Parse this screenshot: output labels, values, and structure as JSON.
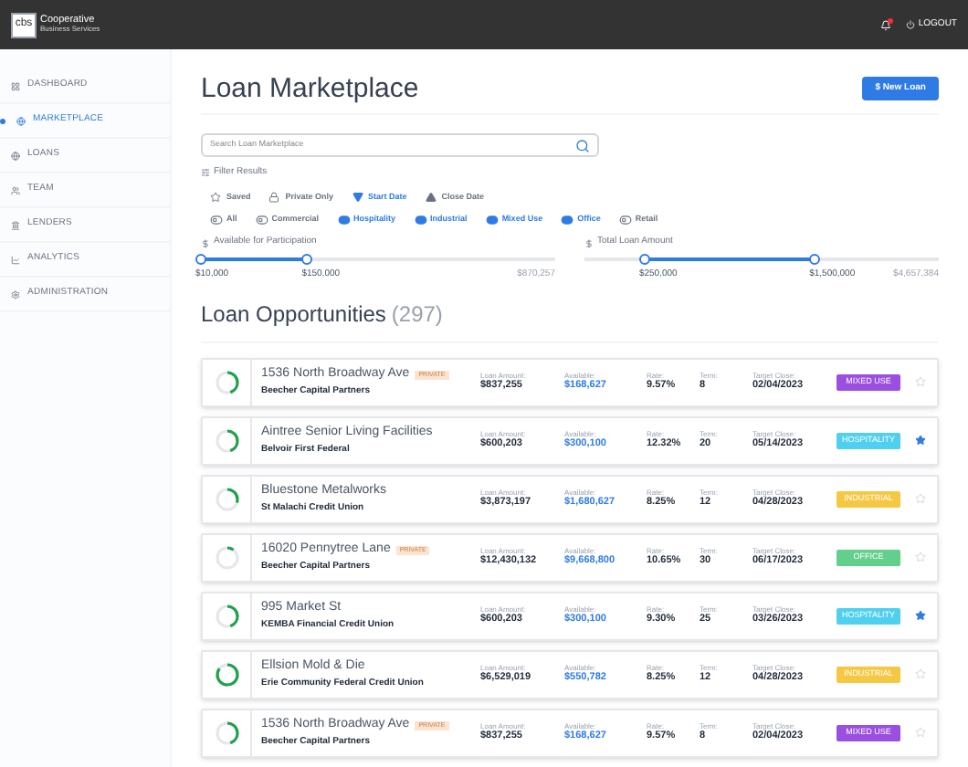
{
  "header": {
    "logo": "cbs",
    "brand": "Cooperative",
    "tagline": "Business Services",
    "logout": "LOGOUT"
  },
  "sidebar": {
    "items": [
      {
        "label": "DASHBOARD",
        "selected": false
      },
      {
        "label": "MARKETPLACE",
        "selected": true
      },
      {
        "label": "LOANS",
        "selected": false
      },
      {
        "label": "TEAM",
        "selected": false
      },
      {
        "label": "LENDERS",
        "selected": false
      },
      {
        "label": "ANALYTICS",
        "selected": false
      },
      {
        "label": "ADMINISTRATION",
        "selected": false
      }
    ]
  },
  "page": {
    "title": "Loan Marketplace",
    "new_button": "$ New Loan"
  },
  "search": {
    "placeholder": "Search Loan Marketplace"
  },
  "filters": {
    "label": "Filter Results",
    "sort": [
      {
        "kind": "star",
        "label": "Saved",
        "selected": false
      },
      {
        "kind": "lock",
        "label": "Private Only",
        "selected": false
      },
      {
        "kind": "down",
        "label": "Start Date",
        "selected": true
      },
      {
        "kind": "up",
        "label": "Close Date",
        "selected": false
      }
    ],
    "types": [
      {
        "label": "All",
        "on": false
      },
      {
        "label": "Commercial",
        "on": false
      },
      {
        "label": "Hospitality",
        "on": true
      },
      {
        "label": "Industrial",
        "on": true
      },
      {
        "label": "Mixed Use",
        "on": true
      },
      {
        "label": "Office",
        "on": true
      },
      {
        "label": "Retail",
        "on": false
      }
    ]
  },
  "ranges": [
    {
      "label": "Available for Participation",
      "handles": [
        {
          "level": 0,
          "value": "$10,000"
        },
        {
          "level": 0.3,
          "value": "$150,000"
        }
      ],
      "max": "$870,257"
    },
    {
      "label": "Total Loan Amount",
      "handles": [
        {
          "level": 0.17,
          "value": "$250,000"
        },
        {
          "level": 0.65,
          "value": "$1,500,000"
        }
      ],
      "max": "$4,657,384"
    }
  ],
  "opportunities": {
    "title": "Loan Opportunities",
    "count": "(297)",
    "rows": [
      {
        "name": "1536 North Broadway Ave",
        "private": "PRIVATE",
        "lender": "Beecher Capital Partners",
        "fields": [
          {
            "kind": "plain",
            "label": "Loan Amount:",
            "value": "$837,255"
          },
          {
            "kind": "highlight",
            "label": "Available:",
            "value": "$168,627"
          },
          {
            "kind": "plain",
            "label": "Rate:",
            "value": "9.57%"
          },
          {
            "kind": "plain",
            "label": "Term:",
            "value": "8"
          },
          {
            "kind": "plain",
            "label": "Target Close:",
            "value": "02/04/2023"
          }
        ],
        "tag": "MIXED USE",
        "color": "#9b4fe0",
        "saved": false
      },
      {
        "name": "Aintree Senior Living Facilities",
        "lender": "Belvoir First Federal",
        "fields": [
          {
            "kind": "plain",
            "label": "Loan Amount:",
            "value": "$600,203"
          },
          {
            "kind": "highlight",
            "label": "Available:",
            "value": "$300,100"
          },
          {
            "kind": "plain",
            "label": "Rate:",
            "value": "12.32%"
          },
          {
            "kind": "plain",
            "label": "Term:",
            "value": "20"
          },
          {
            "kind": "plain",
            "label": "Target Close:",
            "value": "05/14/2023"
          }
        ],
        "tag": "HOSPITALITY",
        "color": "#4fd0f0",
        "saved": true
      },
      {
        "name": "Bluestone Metalworks",
        "lender": "St Malachi Credit Union",
        "fields": [
          {
            "kind": "plain",
            "label": "Loan Amount:",
            "value": "$3,873,197"
          },
          {
            "kind": "highlight",
            "label": "Available:",
            "value": "$1,680,627"
          },
          {
            "kind": "plain",
            "label": "Rate:",
            "value": "8.25%"
          },
          {
            "kind": "plain",
            "label": "Term:",
            "value": "12"
          },
          {
            "kind": "plain",
            "label": "Target Close:",
            "value": "04/28/2023"
          }
        ],
        "tag": "INDUSTRIAL",
        "color": "#f5c843",
        "saved": false
      },
      {
        "name": "16020 Pennytree Lane",
        "private": "PRIVATE",
        "lender": "Beecher Capital Partners",
        "fields": [
          {
            "kind": "plain",
            "label": "Loan Amount:",
            "value": "$12,430,132"
          },
          {
            "kind": "highlight",
            "label": "Available:",
            "value": "$9,668,800"
          },
          {
            "kind": "plain",
            "label": "Rate:",
            "value": "10.65%"
          },
          {
            "kind": "plain",
            "label": "Term:",
            "value": "30"
          },
          {
            "kind": "plain",
            "label": "Target Close:",
            "value": "06/17/2023"
          }
        ],
        "tag": "OFFICE",
        "color": "#63cf8c",
        "saved": false
      },
      {
        "name": "995 Market St",
        "lender": "KEMBA Financial Credit Union",
        "fields": [
          {
            "kind": "plain",
            "label": "Loan Amount:",
            "value": "$600,203"
          },
          {
            "kind": "highlight",
            "label": "Available:",
            "value": "$300,100"
          },
          {
            "kind": "plain",
            "label": "Rate:",
            "value": "9.30%"
          },
          {
            "kind": "plain",
            "label": "Term:",
            "value": "25"
          },
          {
            "kind": "plain",
            "label": "Target Close:",
            "value": "03/26/2023"
          }
        ],
        "tag": "HOSPITALITY",
        "color": "#4fd0f0",
        "saved": true
      },
      {
        "name": "Ellsion Mold & Die",
        "lender": "Erie Community Federal Credit Union",
        "fields": [
          {
            "kind": "plain",
            "label": "Loan Amount:",
            "value": "$6,529,019"
          },
          {
            "kind": "highlight",
            "label": "Available:",
            "value": "$550,782"
          },
          {
            "kind": "plain",
            "label": "Rate:",
            "value": "8.25%"
          },
          {
            "kind": "plain",
            "label": "Term:",
            "value": "12"
          },
          {
            "kind": "plain",
            "label": "Target Close:",
            "value": "04/28/2023"
          }
        ],
        "tag": "INDUSTRIAL",
        "color": "#f5c843",
        "saved": false
      },
      {
        "name": "1536 North Broadway Ave",
        "private": "PRIVATE",
        "lender": "Beecher Capital Partners",
        "fields": [
          {
            "kind": "plain",
            "label": "Loan Amount:",
            "value": "$837,255"
          },
          {
            "kind": "highlight",
            "label": "Available:",
            "value": "$168,627"
          },
          {
            "kind": "plain",
            "label": "Rate:",
            "value": "9.57%"
          },
          {
            "kind": "plain",
            "label": "Term:",
            "value": "8"
          },
          {
            "kind": "plain",
            "label": "Target Close:",
            "value": "02/04/2023"
          }
        ],
        "tag": "MIXED USE",
        "color": "#9b4fe0",
        "saved": false
      }
    ]
  }
}
